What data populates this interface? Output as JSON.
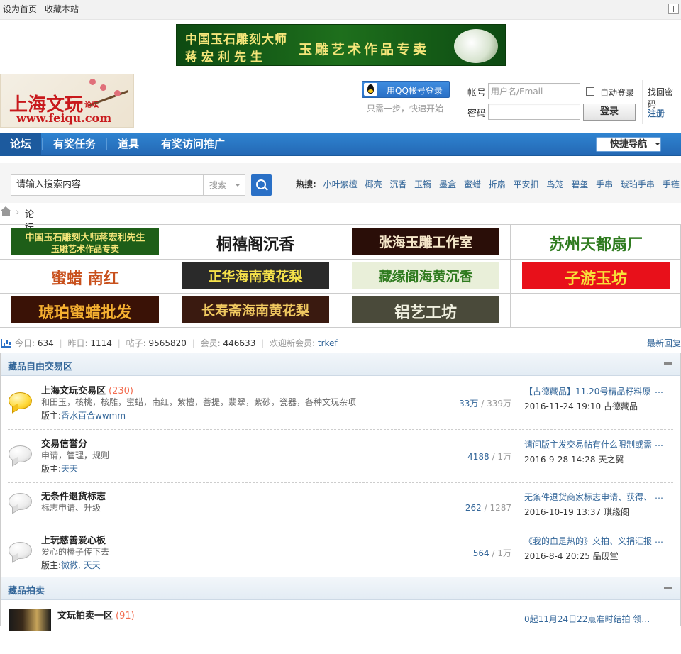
{
  "topbar": {
    "set_home": "设为首页",
    "bookmark": "收藏本站"
  },
  "top_banner": {
    "line1": "中国玉石雕刻大师",
    "line2": "蒋宏利先生",
    "line3": "玉雕艺术作品专卖"
  },
  "logo": {
    "name": "上海文玩",
    "sub": "论坛",
    "url": "www.feiqu.com"
  },
  "qq_login": {
    "label": "用QQ帐号登录",
    "tip": "只需一步，快速开始"
  },
  "login": {
    "account_label": "帐号",
    "account_placeholder": "用户名/Email",
    "password_label": "密码",
    "auto_login": "自动登录",
    "forgot": "找回密码",
    "register": "注册",
    "submit": "登录"
  },
  "nav": {
    "items": [
      "论坛",
      "有奖任务",
      "道具",
      "有奖访问推广"
    ],
    "quick_nav": "快捷导航"
  },
  "search": {
    "placeholder": "请输入搜索内容",
    "type": "搜索",
    "hot_label": "热搜:",
    "hot": [
      "小叶紫檀",
      "椰壳",
      "沉香",
      "玉镯",
      "墨盒",
      "蜜蜡",
      "折扇",
      "平安扣",
      "鸟笼",
      "碧玺",
      "手串",
      "琥珀手串",
      "手链"
    ]
  },
  "breadcrumb": {
    "current": "论坛"
  },
  "ads": [
    {
      "text": "中国玉石雕刻大师蒋宏利先生",
      "text2": "玉雕艺术作品专卖",
      "bg": "#1e5e18",
      "fg": "#f5e67a"
    },
    {
      "text": "桐禧阁沉香",
      "bg": "#ffffff",
      "fg": "#1a1a1a"
    },
    {
      "text": "张海玉雕工作室",
      "bg": "#2a0e08",
      "fg": "#f5e6c8"
    },
    {
      "text": "苏州天都扇厂",
      "bg": "#ffffff",
      "fg": "#2f7b1f"
    },
    {
      "text": "蜜蜡 南红",
      "bg": "#ffffff",
      "fg": "#c8501c"
    },
    {
      "text": "正华海南黄花梨",
      "bg": "#2a2a2a",
      "fg": "#f5e14a"
    },
    {
      "text": "藏缘阁海黄沉香",
      "bg": "#e9efd9",
      "fg": "#2f7b1f"
    },
    {
      "text": "子游玉坊",
      "bg": "#e8101a",
      "fg": "#f8e03a"
    },
    {
      "text": "琥珀蜜蜡批发",
      "bg": "#3a1206",
      "fg": "#f5b030"
    },
    {
      "text": "长寿斋海南黄花梨",
      "bg": "#3a1a10",
      "fg": "#f0c860"
    },
    {
      "text": "铝艺工坊",
      "bg": "#4a4a3a",
      "fg": "#f0f0e0"
    }
  ],
  "stats": {
    "today_label": "今日:",
    "today": "634",
    "yesterday_label": "昨日:",
    "yesterday": "1114",
    "posts_label": "帖子:",
    "posts": "9565820",
    "members_label": "会员:",
    "members": "446633",
    "welcome_label": "欢迎新会员:",
    "welcome": "trkef",
    "newest": "最新回复"
  },
  "sections": [
    {
      "title": "藏品自由交易区",
      "forums": [
        {
          "name": "上海文玩交易区",
          "count": "(230)",
          "desc": "和田玉，核桃，核雕，蜜蜡，南红，紫檀，菩提，翡翠，紫砂，瓷器，各种文玩杂项",
          "mod_label": "版主:",
          "mods": "香水百合wwmm",
          "threads": "33万",
          "posts": "339万",
          "last_title": "【古德藏品】11.20号精品籽料原",
          "last_meta": "2016-11-24 19:10 古德藏品",
          "new": true
        },
        {
          "name": "交易信誉分",
          "count": "",
          "desc": "申请，管理，规则",
          "mod_label": "版主:",
          "mods": "天天",
          "threads": "4188",
          "posts": "1万",
          "last_title": "请问版主发交易帖有什么限制或需",
          "last_meta": "2016-9-28 14:28 天之翼",
          "new": false
        },
        {
          "name": "无条件退货标志",
          "count": "",
          "desc": "标志申请、升级",
          "mod_label": "",
          "mods": "",
          "threads": "262",
          "posts": "1287",
          "last_title": "无条件退货商家标志申请、获得、",
          "last_meta": "2016-10-19 13:37 琪缘阁",
          "new": false
        },
        {
          "name": "上玩慈善爱心板",
          "count": "",
          "desc": "爱心的棒子传下去",
          "mod_label": "版主:",
          "mods": "微微, 天天",
          "threads": "564",
          "posts": "1万",
          "last_title": "《我的血是热的》义拍、义捐汇报",
          "last_meta": "2016-8-4 20:25 品砚堂",
          "new": false
        }
      ]
    },
    {
      "title": "藏品拍卖",
      "forums": [
        {
          "name": "文玩拍卖一区",
          "count": "(91)",
          "last_title": "0起11月24日22点准时结拍 领阅天"
        }
      ]
    }
  ],
  "more_glyph": "…",
  "sep_glyph": "/"
}
